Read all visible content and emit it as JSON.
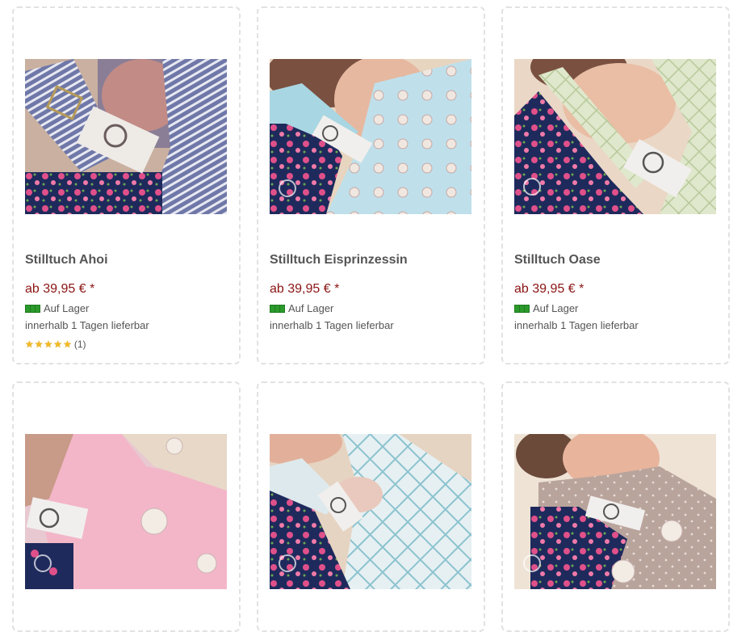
{
  "products": [
    {
      "name": "Stilltuch Ahoi",
      "price": "ab 39,95 € *",
      "stock": "Auf Lager",
      "delivery": "innerhalb 1 Tagen lieferbar",
      "rating": 5,
      "rating_count": "(1)",
      "image": "stilltuch-ahoi-photo"
    },
    {
      "name": "Stilltuch Eisprinzessin",
      "price": "ab 39,95 € *",
      "stock": "Auf Lager",
      "delivery": "innerhalb 1 Tagen lieferbar",
      "image": "stilltuch-eisprinzessin-photo"
    },
    {
      "name": "Stilltuch Oase",
      "price": "ab 39,95 € *",
      "stock": "Auf Lager",
      "delivery": "innerhalb 1 Tagen lieferbar",
      "image": "stilltuch-oase-photo"
    },
    {
      "image": "stilltuch-pink-photo"
    },
    {
      "image": "stilltuch-blue-pattern-photo"
    },
    {
      "image": "stilltuch-taupe-photo"
    }
  ],
  "colors": {
    "price": "#8b1414",
    "title": "#555555",
    "card_border": "#e2e2e2",
    "stock_icon": "#2b9a2b",
    "star": "#f3b920"
  },
  "icons": {
    "stock": "stock-available-icon",
    "star": "star-icon"
  }
}
